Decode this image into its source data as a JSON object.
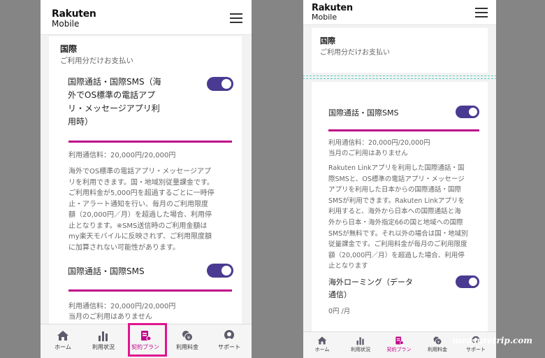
{
  "left": {
    "logo_top": "Rakuten",
    "logo_bottom": "Mobile",
    "section_title": "国際",
    "section_sub": "ご利用分だけお支払い",
    "item1_title_lines": [
      "国際通話・国際SMS（海",
      "外でOS標準の電話アプ",
      "リ・メッセージアプリ利",
      "用時）"
    ],
    "item1_usage": "利用通信料：20,000円/20,000円",
    "item1_desc_lines": [
      "海外でOS標準の電話アプリ・メッセージアプ",
      "リを利用できます。国・地域別従量課金です。",
      "ご利用料金が5,000円を超過するごとに一時停",
      "止・アラート通知を行い、毎月のご利用限度",
      "額（20,000円／月）を超過した場合、利用停",
      "止となります。※SMS送信時のご利用金額は",
      "my楽天モバイルに反映されず、ご利用限度額",
      "に加算されない可能性があります。"
    ],
    "item2_title": "国際通話・国際SMS",
    "item2_usage": "利用通信料：20,000円/20,000円",
    "item2_note": "当月のご利用はありません",
    "nav": [
      "ホーム",
      "利用状況",
      "契約プラン",
      "利用料金",
      "サポート"
    ]
  },
  "right": {
    "logo_top": "Rakuten",
    "logo_bottom": "Mobile",
    "section_title": "国際",
    "section_sub": "ご利用分だけお支払い",
    "item1_title": "国際通話・国際SMS",
    "item1_usage": "利用通信料：20,000円/20,000円",
    "item1_note": "当月のご利用はありません",
    "item1_desc_lines": [
      "Rakuten Linkアプリを利用した国際通話・国",
      "際SMSと、OS標準の電話アプリ・メッセージ",
      "アプリを利用した日本からの国際通話・国際",
      "SMSが利用できます。Rakuten Linkアプリを",
      "利用すると、海外から日本への国際通話と海",
      "外から日本・海外指定66の国と地域への国際",
      "SMSが無料です。それ以外の場合は国・地域別",
      "従量課金です。ご利用料金が毎月のご利用限度",
      "額（20,000円／月）を超過した場合、利用停",
      "止となります"
    ],
    "item2_title_lines": [
      "海外ローミング（データ",
      "通信）"
    ],
    "item2_value": "0円 /月",
    "nav": [
      "ホーム",
      "利用状況",
      "契約プラン",
      "利用料金",
      "サポート"
    ]
  },
  "watermark": "measuretrip.com",
  "colors": {
    "accent": "#bf0a8a",
    "toggle": "#4a3a91",
    "highlight": "#e0158f"
  },
  "icons": [
    "home-icon",
    "usage-chart-icon",
    "contract-plan-icon",
    "billing-yen-icon",
    "support-person-icon",
    "hamburger-menu-icon"
  ]
}
